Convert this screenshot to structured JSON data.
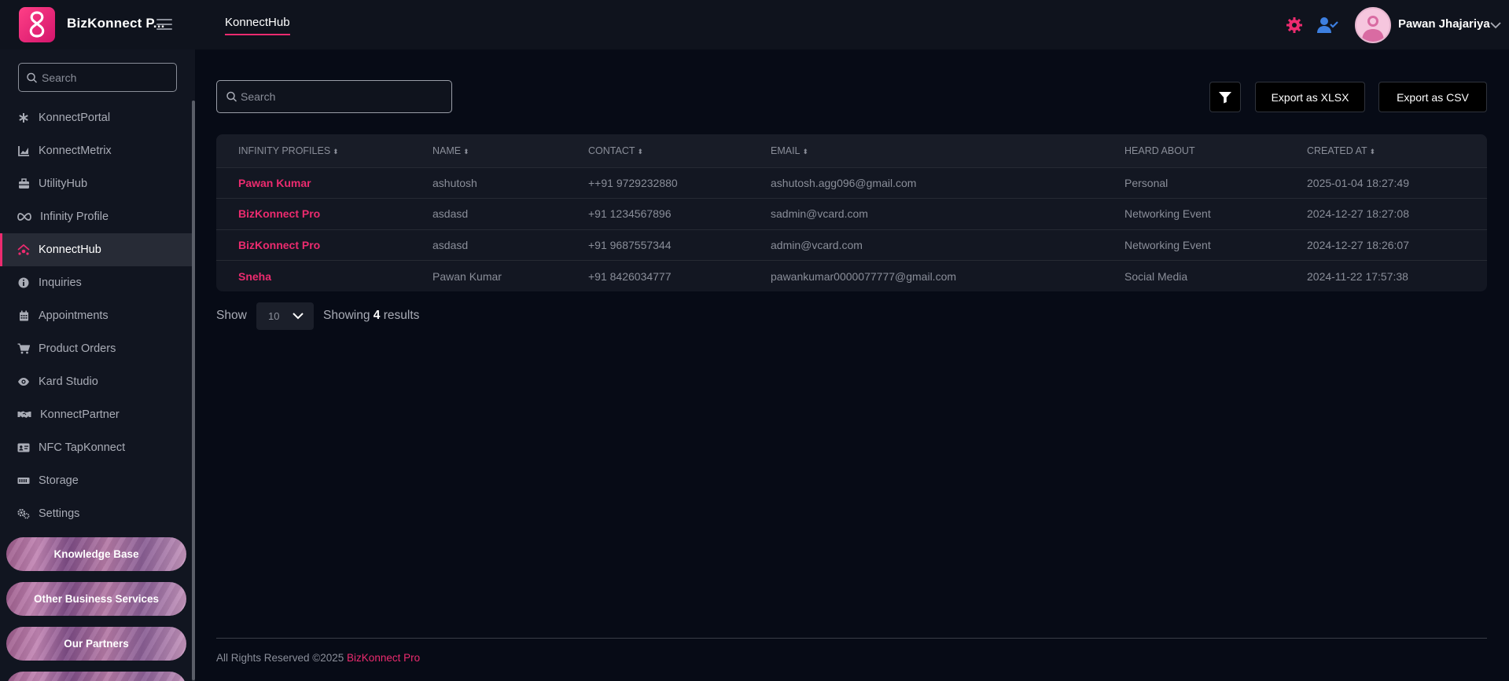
{
  "header": {
    "brand": "BizKonnect P...",
    "active_tab": "KonnectHub",
    "user_name": "Pawan Jhajariya",
    "accent_color": "#ec2b6f"
  },
  "sidebar": {
    "search_placeholder": "Search",
    "items": [
      {
        "label": "KonnectPortal",
        "icon": "asterisk-icon"
      },
      {
        "label": "KonnectMetrix",
        "icon": "chart-icon"
      },
      {
        "label": "UtilityHub",
        "icon": "toolbox-icon"
      },
      {
        "label": "Infinity Profile",
        "icon": "infinity-icon"
      },
      {
        "label": "KonnectHub",
        "icon": "hub-icon",
        "active": true
      },
      {
        "label": "Inquiries",
        "icon": "info-icon"
      },
      {
        "label": "Appointments",
        "icon": "calendar-icon"
      },
      {
        "label": "Product Orders",
        "icon": "cart-icon"
      },
      {
        "label": "Kard Studio",
        "icon": "eye-icon"
      },
      {
        "label": "KonnectPartner",
        "icon": "handshake-icon"
      },
      {
        "label": "NFC TapKonnect",
        "icon": "id-card-icon"
      },
      {
        "label": "Storage",
        "icon": "storage-icon"
      },
      {
        "label": "Settings",
        "icon": "gears-icon"
      }
    ],
    "promos": [
      "Knowledge Base",
      "Other Business Services",
      "Our Partners"
    ]
  },
  "main": {
    "search_placeholder": "Search",
    "export_xlsx": "Export as XLSX",
    "export_csv": "Export as CSV",
    "table": {
      "columns": [
        "INFINITY PROFILES",
        "NAME",
        "CONTACT",
        "EMAIL",
        "HEARD ABOUT",
        "CREATED AT"
      ],
      "rows": [
        [
          "Pawan Kumar",
          "ashutosh",
          "++91 9729232880",
          "ashutosh.agg096@gmail.com",
          "Personal",
          "2025-01-04 18:27:49"
        ],
        [
          "BizKonnect Pro",
          "asdasd",
          "+91 1234567896",
          "sadmin@vcard.com",
          "Networking Event",
          "2024-12-27 18:27:08"
        ],
        [
          "BizKonnect Pro",
          "asdasd",
          "+91 9687557344",
          "admin@vcard.com",
          "Networking Event",
          "2024-12-27 18:26:07"
        ],
        [
          "Sneha",
          "Pawan Kumar",
          "+91 8426034777",
          "pawankumar0000077777@gmail.com",
          "Social Media",
          "2024-11-22 17:57:38"
        ]
      ]
    },
    "pagination": {
      "show_label": "Show",
      "page_size": "10",
      "showing_prefix": "Showing",
      "count": "4",
      "showing_suffix": "results"
    }
  },
  "footer": {
    "text": "All Rights Reserved ©2025",
    "brand": "BizKonnect Pro"
  }
}
